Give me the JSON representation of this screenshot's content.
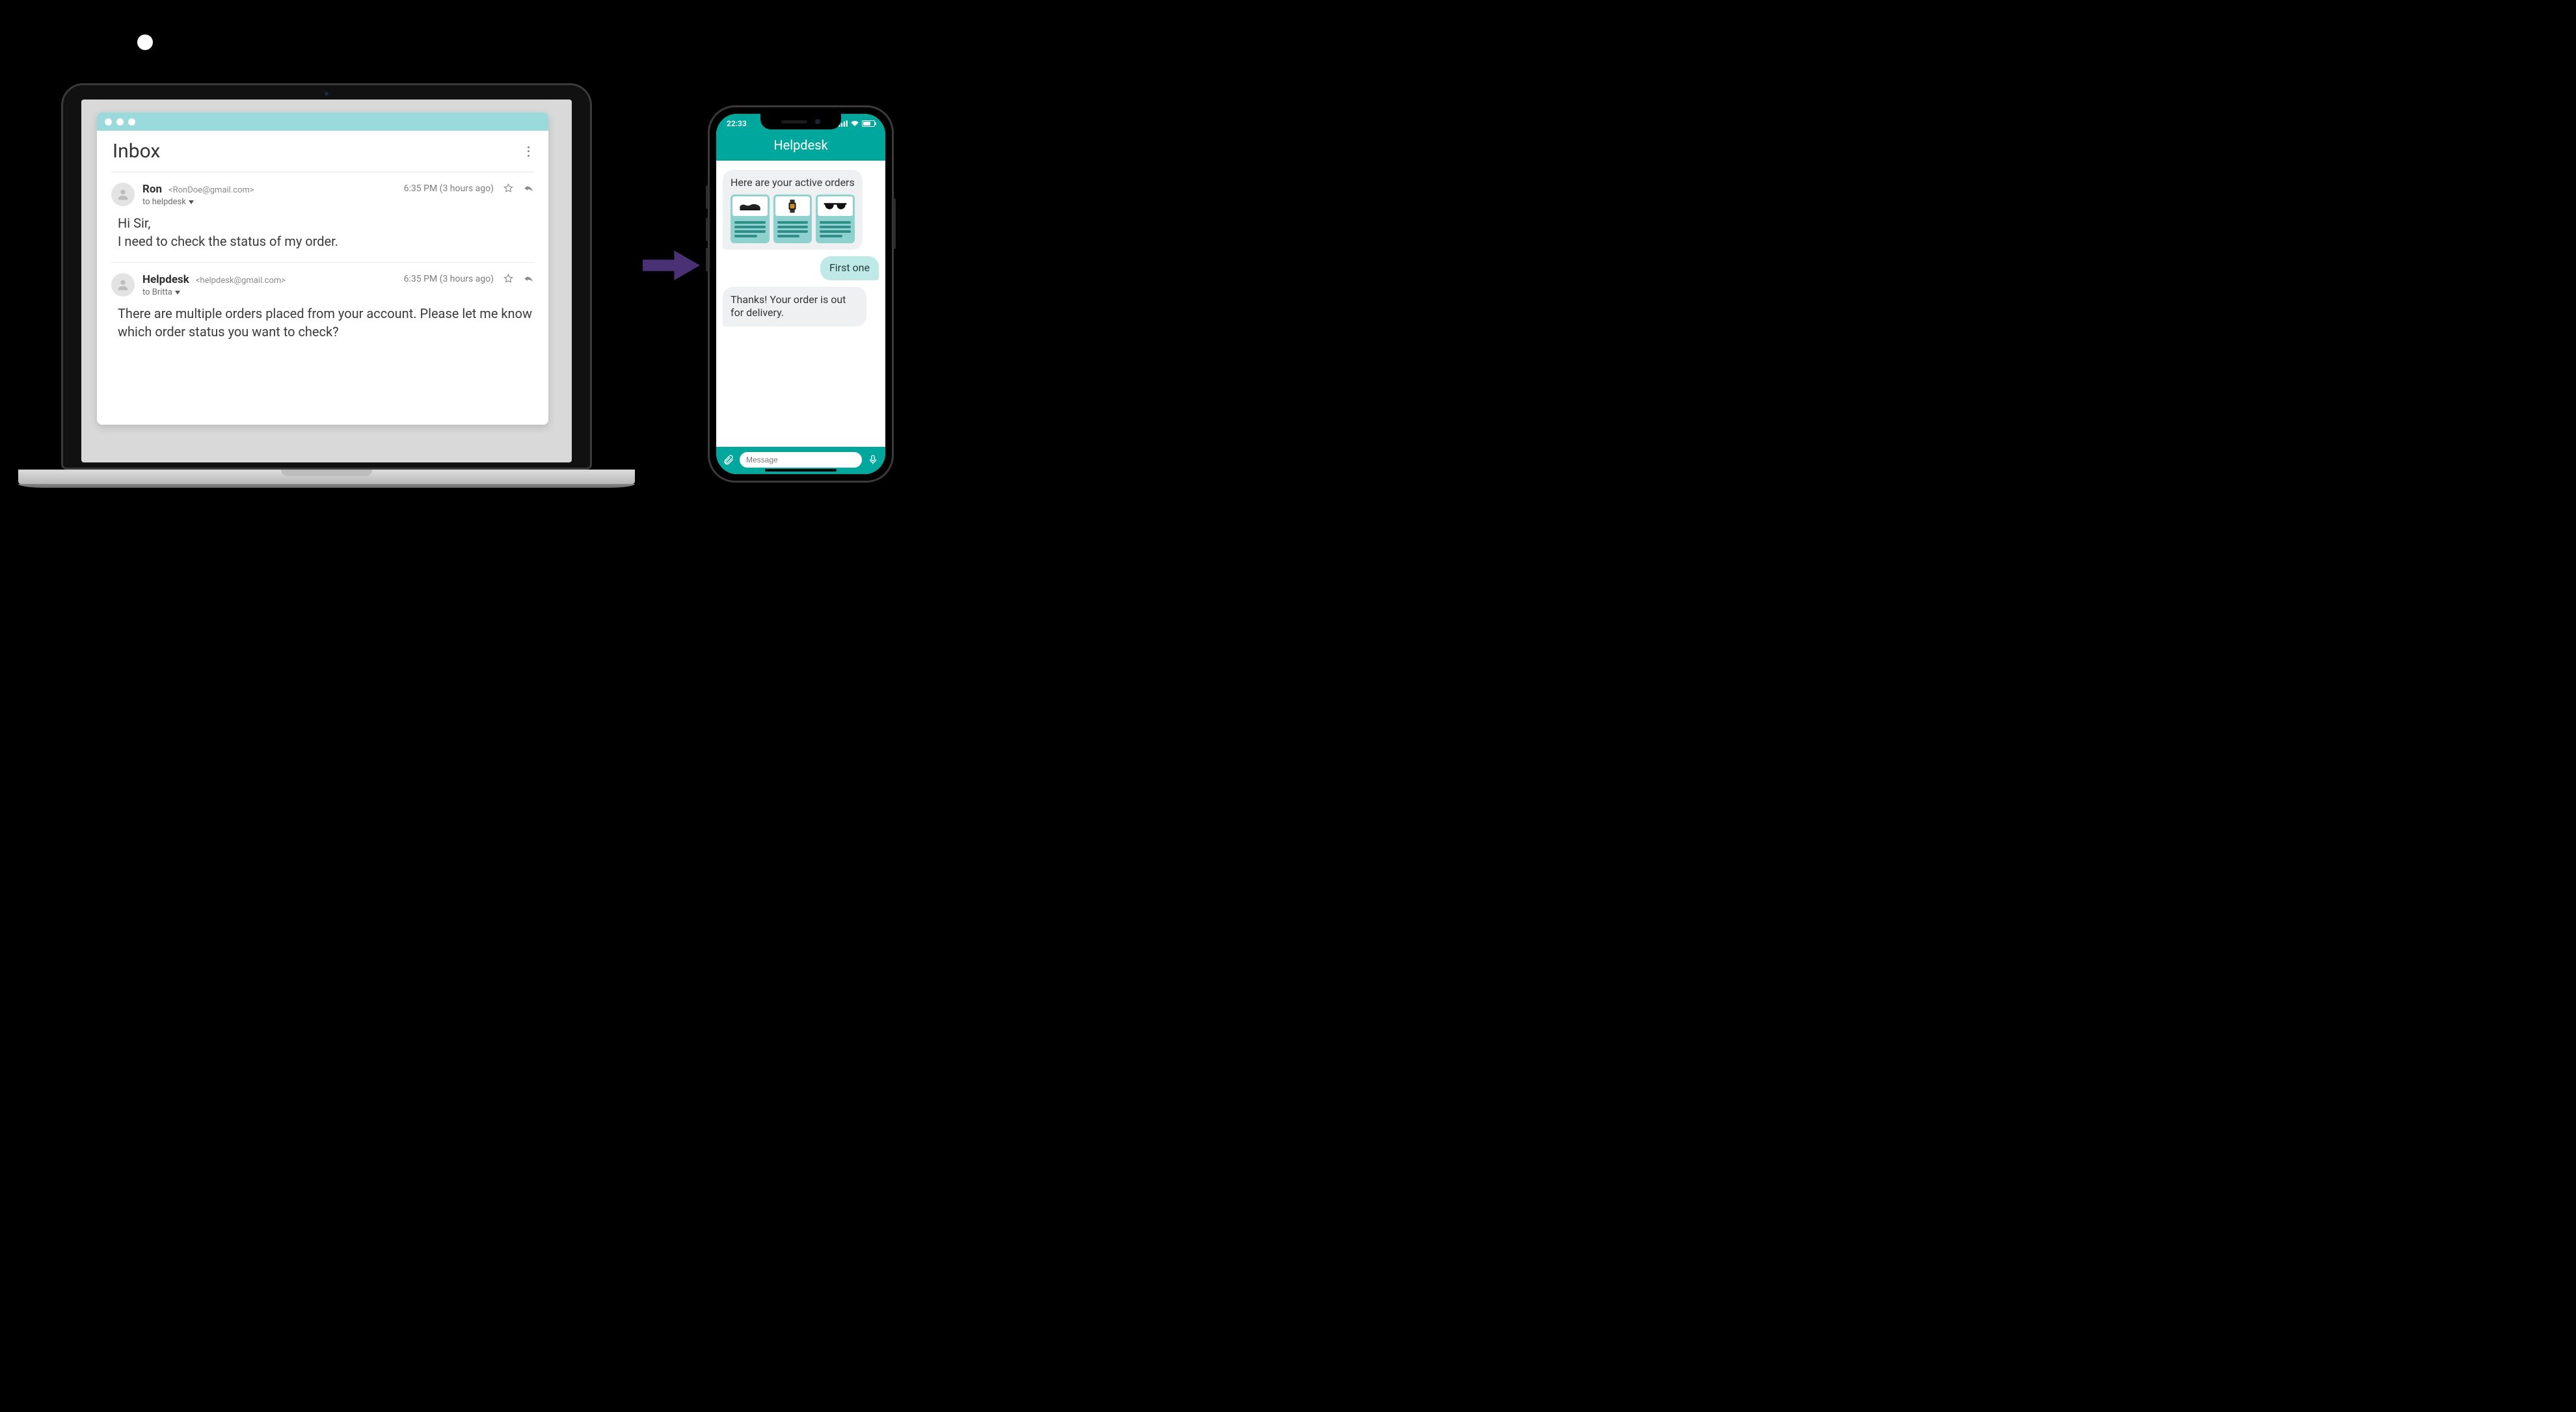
{
  "laptop": {
    "inbox_title": "Inbox",
    "messages": [
      {
        "sender_name": "Ron",
        "sender_email": "<RonDoe@gmail.com>",
        "to_line": "to helpdesk",
        "time": "6:35 PM (3 hours ago)",
        "body": "Hi Sir,\nI need to check the status of my order."
      },
      {
        "sender_name": "Helpdesk",
        "sender_email": "<helpdesk@gmail.com>",
        "to_line": "to Britta",
        "time": "6:35 PM (3 hours ago)",
        "body": "There are multiple orders placed from your account. Please let me know which order status you want to check?"
      }
    ]
  },
  "phone": {
    "status_time": "22:33",
    "header": "Helpdesk",
    "bot_intro": "Here are your active orders",
    "cards": [
      {
        "icon": "shoe-icon"
      },
      {
        "icon": "watch-icon"
      },
      {
        "icon": "sunglasses-icon"
      }
    ],
    "user_reply": "First one",
    "bot_followup": "Thanks! Your order is out for delivery.",
    "compose_placeholder": "Message"
  }
}
